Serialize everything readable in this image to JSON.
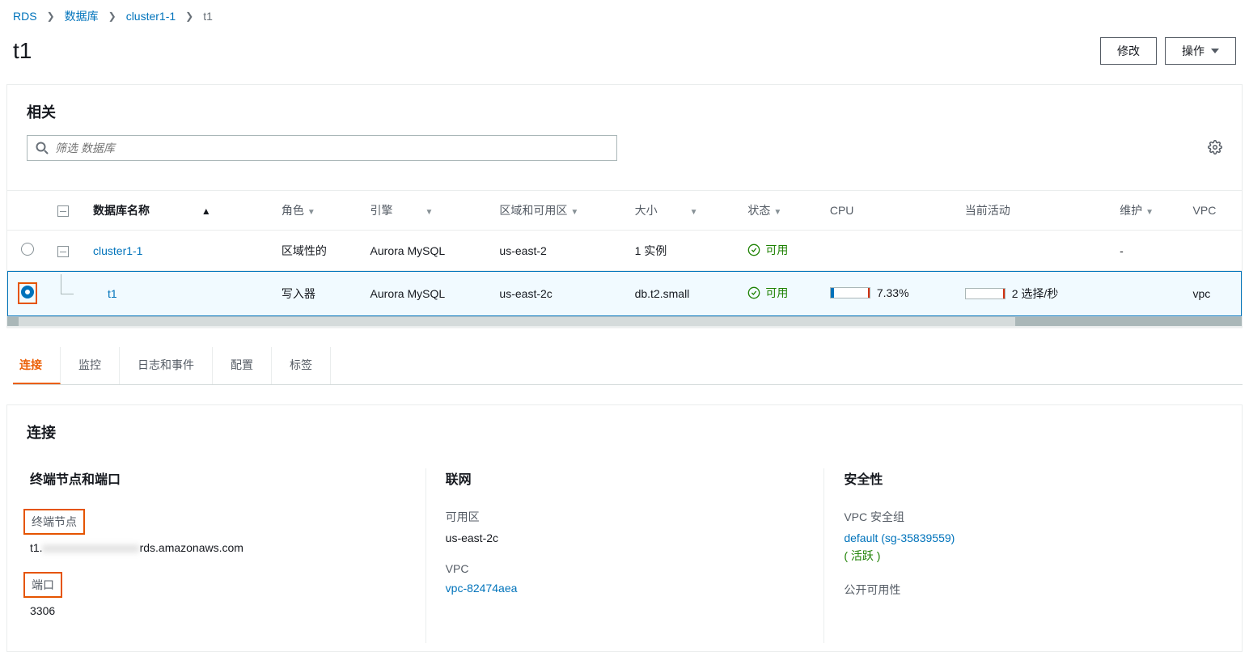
{
  "breadcrumb": {
    "rds": "RDS",
    "databases": "数据库",
    "cluster": "cluster1-1",
    "current": "t1"
  },
  "page": {
    "title": "t1",
    "modify_btn": "修改",
    "actions_btn": "操作"
  },
  "related": {
    "title": "相关",
    "search_placeholder": "筛选 数据库",
    "columns": {
      "name": "数据库名称",
      "role": "角色",
      "engine": "引擎",
      "region_az": "区域和可用区",
      "size": "大小",
      "status": "状态",
      "cpu": "CPU",
      "activity": "当前活动",
      "maintenance": "维护",
      "vpc": "VPC"
    },
    "rows": [
      {
        "name": "cluster1-1",
        "role": "区域性的",
        "engine": "Aurora MySQL",
        "region_az": "us-east-2",
        "size": "1 实例",
        "status": "可用",
        "cpu": "",
        "activity": "",
        "maintenance": "-",
        "vpc": ""
      },
      {
        "name": "t1",
        "role": "写入器",
        "engine": "Aurora MySQL",
        "region_az": "us-east-2c",
        "size": "db.t2.small",
        "status": "可用",
        "cpu": "7.33%",
        "activity": "2 选择/秒",
        "maintenance": "",
        "vpc": "vpc"
      }
    ]
  },
  "tabs": {
    "connect": "连接",
    "monitor": "监控",
    "logs": "日志和事件",
    "config": "配置",
    "tags": "标签"
  },
  "connection": {
    "title": "连接",
    "endpoint_section": "终端节点和端口",
    "networking_section": "联网",
    "security_section": "安全性",
    "endpoint_label": "终端节点",
    "endpoint_value_prefix": "t1.",
    "endpoint_value_suffix": "rds.amazonaws.com",
    "port_label": "端口",
    "port_value": "3306",
    "az_label": "可用区",
    "az_value": "us-east-2c",
    "vpc_label": "VPC",
    "vpc_value": "vpc-82474aea",
    "sg_label": "VPC 安全组",
    "sg_value": "default (sg-35839559)",
    "sg_active": "( 活跃 )",
    "public_label": "公开可用性"
  }
}
